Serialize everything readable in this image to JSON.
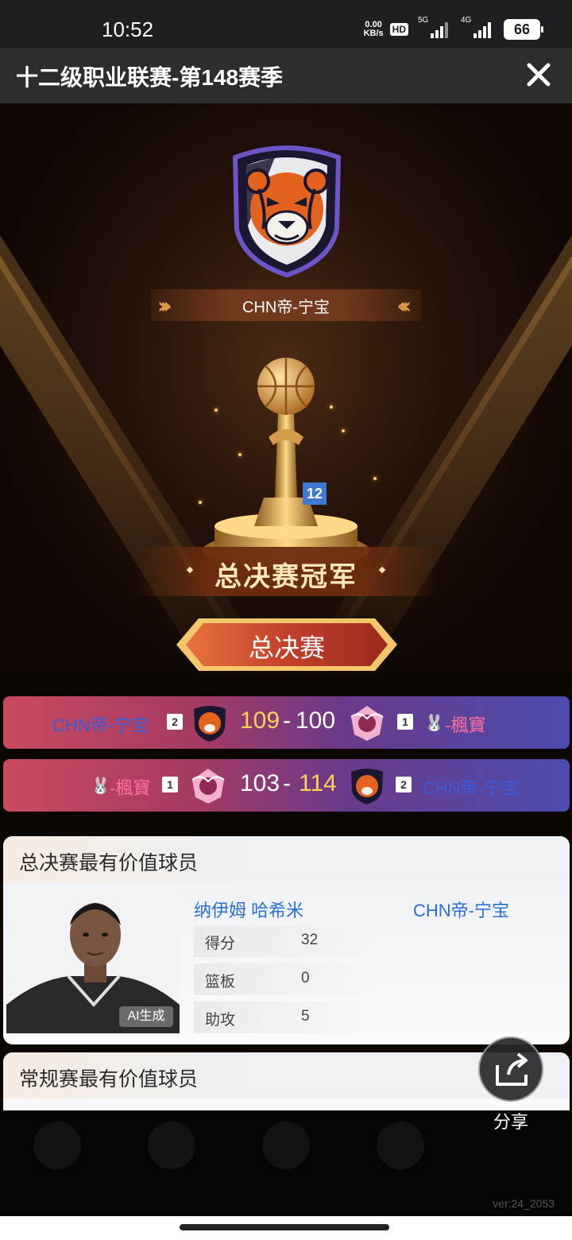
{
  "status_bar": {
    "time": "10:52",
    "net_speed_value": "0.00",
    "net_speed_unit": "KB/s",
    "hd_label": "HD",
    "sim1_label": "5G",
    "sim2_label": "4G",
    "battery": "66"
  },
  "header": {
    "title": "十二级职业联赛-第148赛季",
    "close_icon": "close-icon"
  },
  "hero": {
    "champion_team": "CHN帝-宁宝",
    "trophy_level_badge": "12",
    "champion_title": "总决赛冠军",
    "finals_button_label": "总决赛"
  },
  "matches": [
    {
      "left_team": "CHN帝-宁宝",
      "left_seed": "2",
      "left_score": "109",
      "right_score": "100",
      "right_seed": "1",
      "right_team": "-楓寶"
    },
    {
      "left_team": "-楓寶",
      "left_seed": "1",
      "left_score": "103",
      "right_score": "114",
      "right_seed": "2",
      "right_team": "CHN帝-宁宝"
    }
  ],
  "finals_mvp": {
    "section_title": "总决赛最有价值球员",
    "player_name": "纳伊姆 哈希米",
    "team": "CHN帝-宁宝",
    "ai_tag": "AI生成",
    "stats": [
      {
        "label": "得分",
        "value": "32"
      },
      {
        "label": "篮板",
        "value": "0"
      },
      {
        "label": "助攻",
        "value": "5"
      }
    ]
  },
  "regular_mvp": {
    "section_title": "常规赛最有价值球员"
  },
  "share": {
    "label": "分享"
  },
  "version": "ver:24_2053",
  "colors": {
    "win_score": "#ffd25a",
    "team_blue": "#3b5bd6",
    "team_pink": "#ff6f9c",
    "link_blue": "#2a6fd6"
  }
}
